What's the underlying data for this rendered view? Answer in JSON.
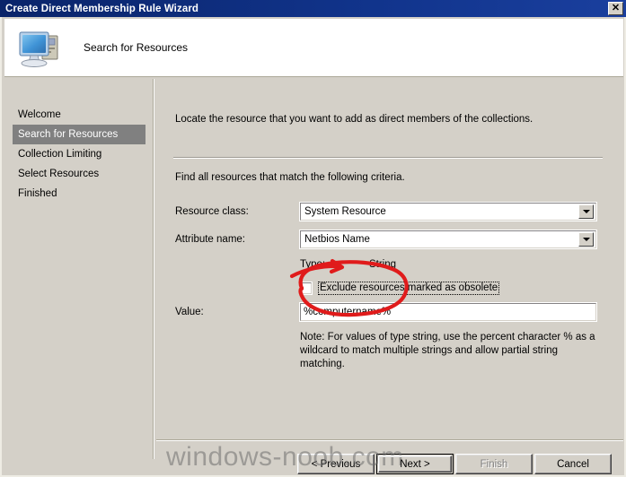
{
  "window": {
    "title": "Create Direct Membership Rule Wizard",
    "close_label": "✕"
  },
  "header": {
    "title": "Search for Resources",
    "icon": "computer-icon"
  },
  "sidebar": {
    "items": [
      {
        "label": "Welcome",
        "selected": false
      },
      {
        "label": "Search for Resources",
        "selected": true
      },
      {
        "label": "Collection Limiting",
        "selected": false
      },
      {
        "label": "Select Resources",
        "selected": false
      },
      {
        "label": "Finished",
        "selected": false
      }
    ]
  },
  "content": {
    "intro": "Locate the resource that you want to add as direct members of the collections.",
    "criteria": "Find all resources that match the following criteria.",
    "fields": {
      "resource_class_label": "Resource class:",
      "resource_class_value": "System Resource",
      "attribute_name_label": "Attribute name:",
      "attribute_name_value": "Netbios Name",
      "type_label": "Type:",
      "type_value": "String",
      "exclude_checkbox_label": "Exclude resources marked as obsolete",
      "exclude_checkbox_checked": false,
      "value_label": "Value:",
      "value_text": "%computername%",
      "value_placeholder": ""
    },
    "note": "Note: For values of type string, use the percent character % as a wildcard to match multiple strings and allow partial string matching."
  },
  "footer": {
    "previous": "< Previous",
    "next": "Next >",
    "finish": "Finish",
    "cancel": "Cancel",
    "finish_disabled": true
  },
  "watermark": {
    "text": "windows-noob.com"
  },
  "annotation": {
    "color": "#e01b1b",
    "shape": "hand-drawn-ellipse-with-arrow"
  }
}
